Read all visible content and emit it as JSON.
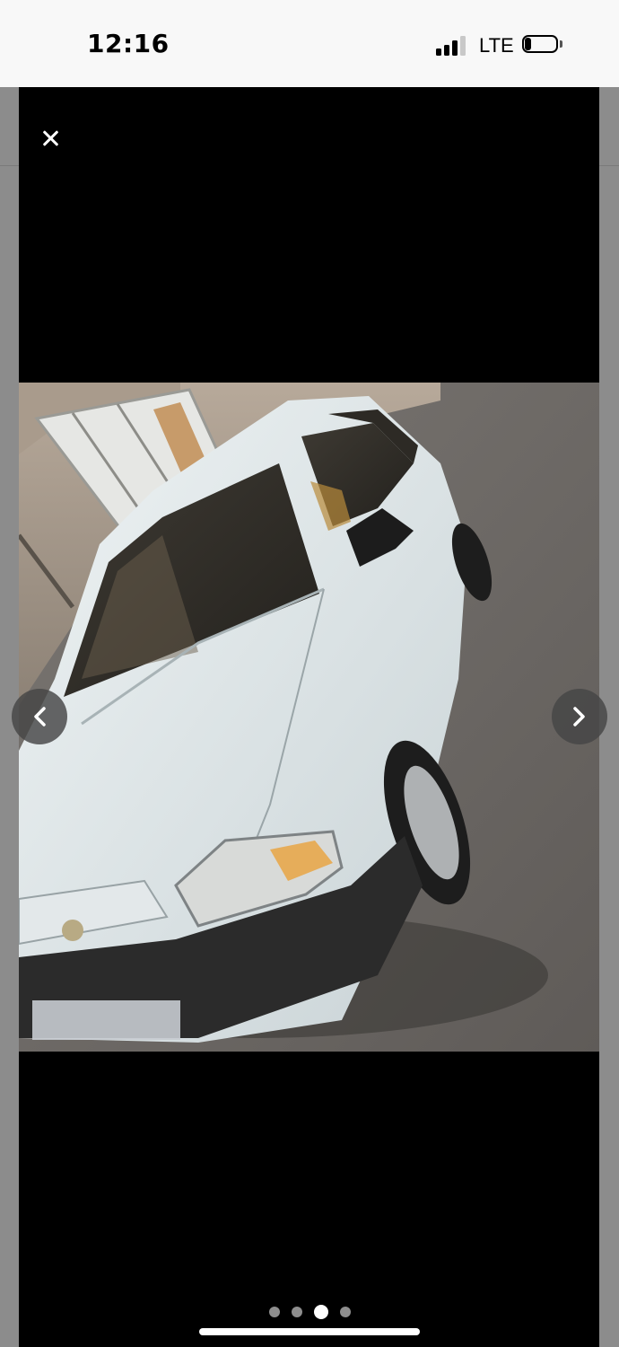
{
  "status_bar": {
    "time": "12:16",
    "network": "LTE",
    "signal_bars": 3,
    "signal_icon": "cellular-signal-icon",
    "battery_icon": "battery-icon",
    "battery_level": 0.2
  },
  "viewer": {
    "close_icon": "close-icon",
    "prev_icon": "chevron-left-icon",
    "next_icon": "chevron-right-icon",
    "photo_count": 4,
    "current_index": 2,
    "background": "#000000"
  }
}
